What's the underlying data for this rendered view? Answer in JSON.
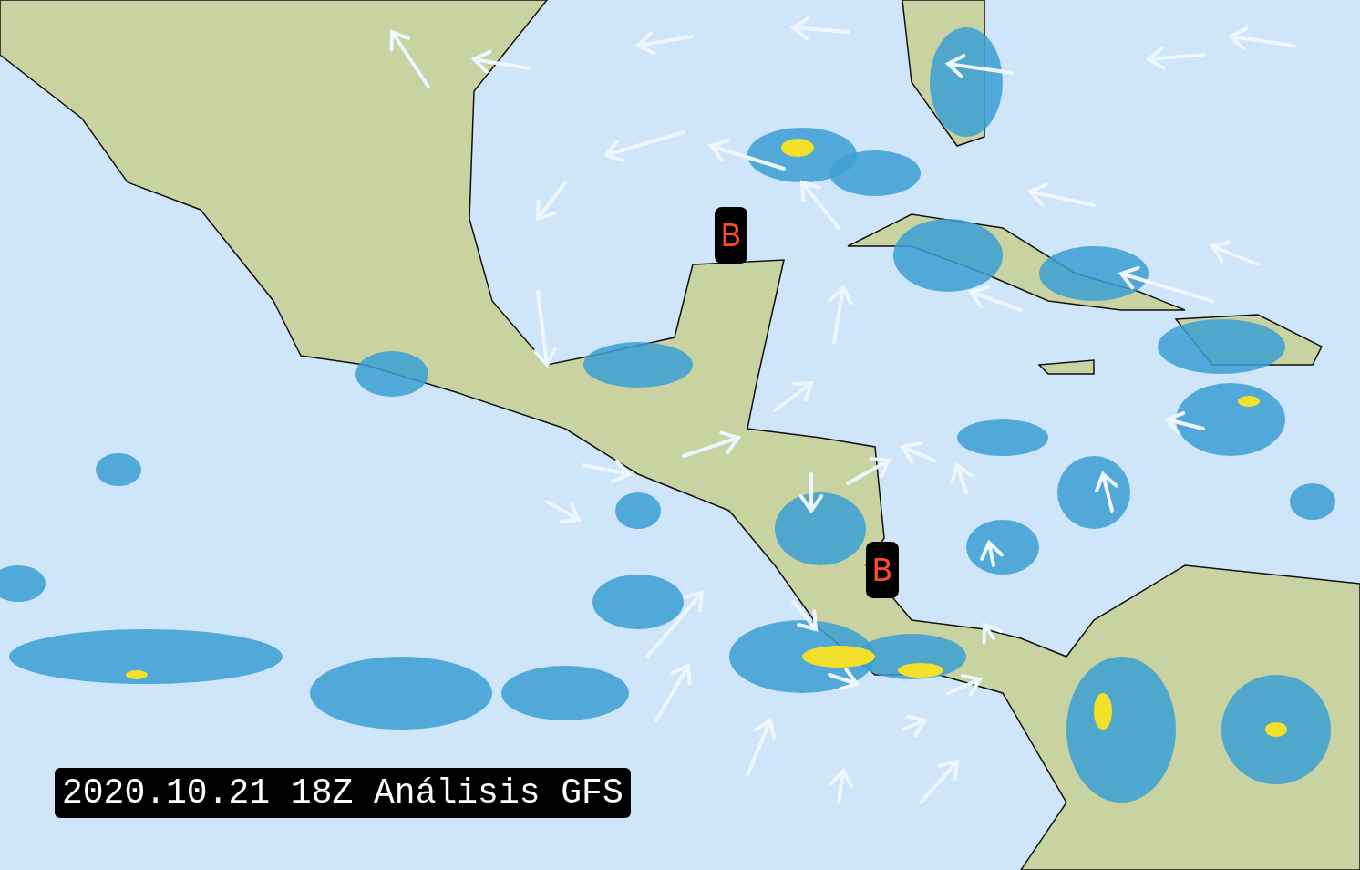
{
  "map": {
    "pressure_markers": [
      {
        "label": "B"
      },
      {
        "label": "B"
      }
    ],
    "timestamp": "2020.10.21 18Z Análisis GFS"
  }
}
